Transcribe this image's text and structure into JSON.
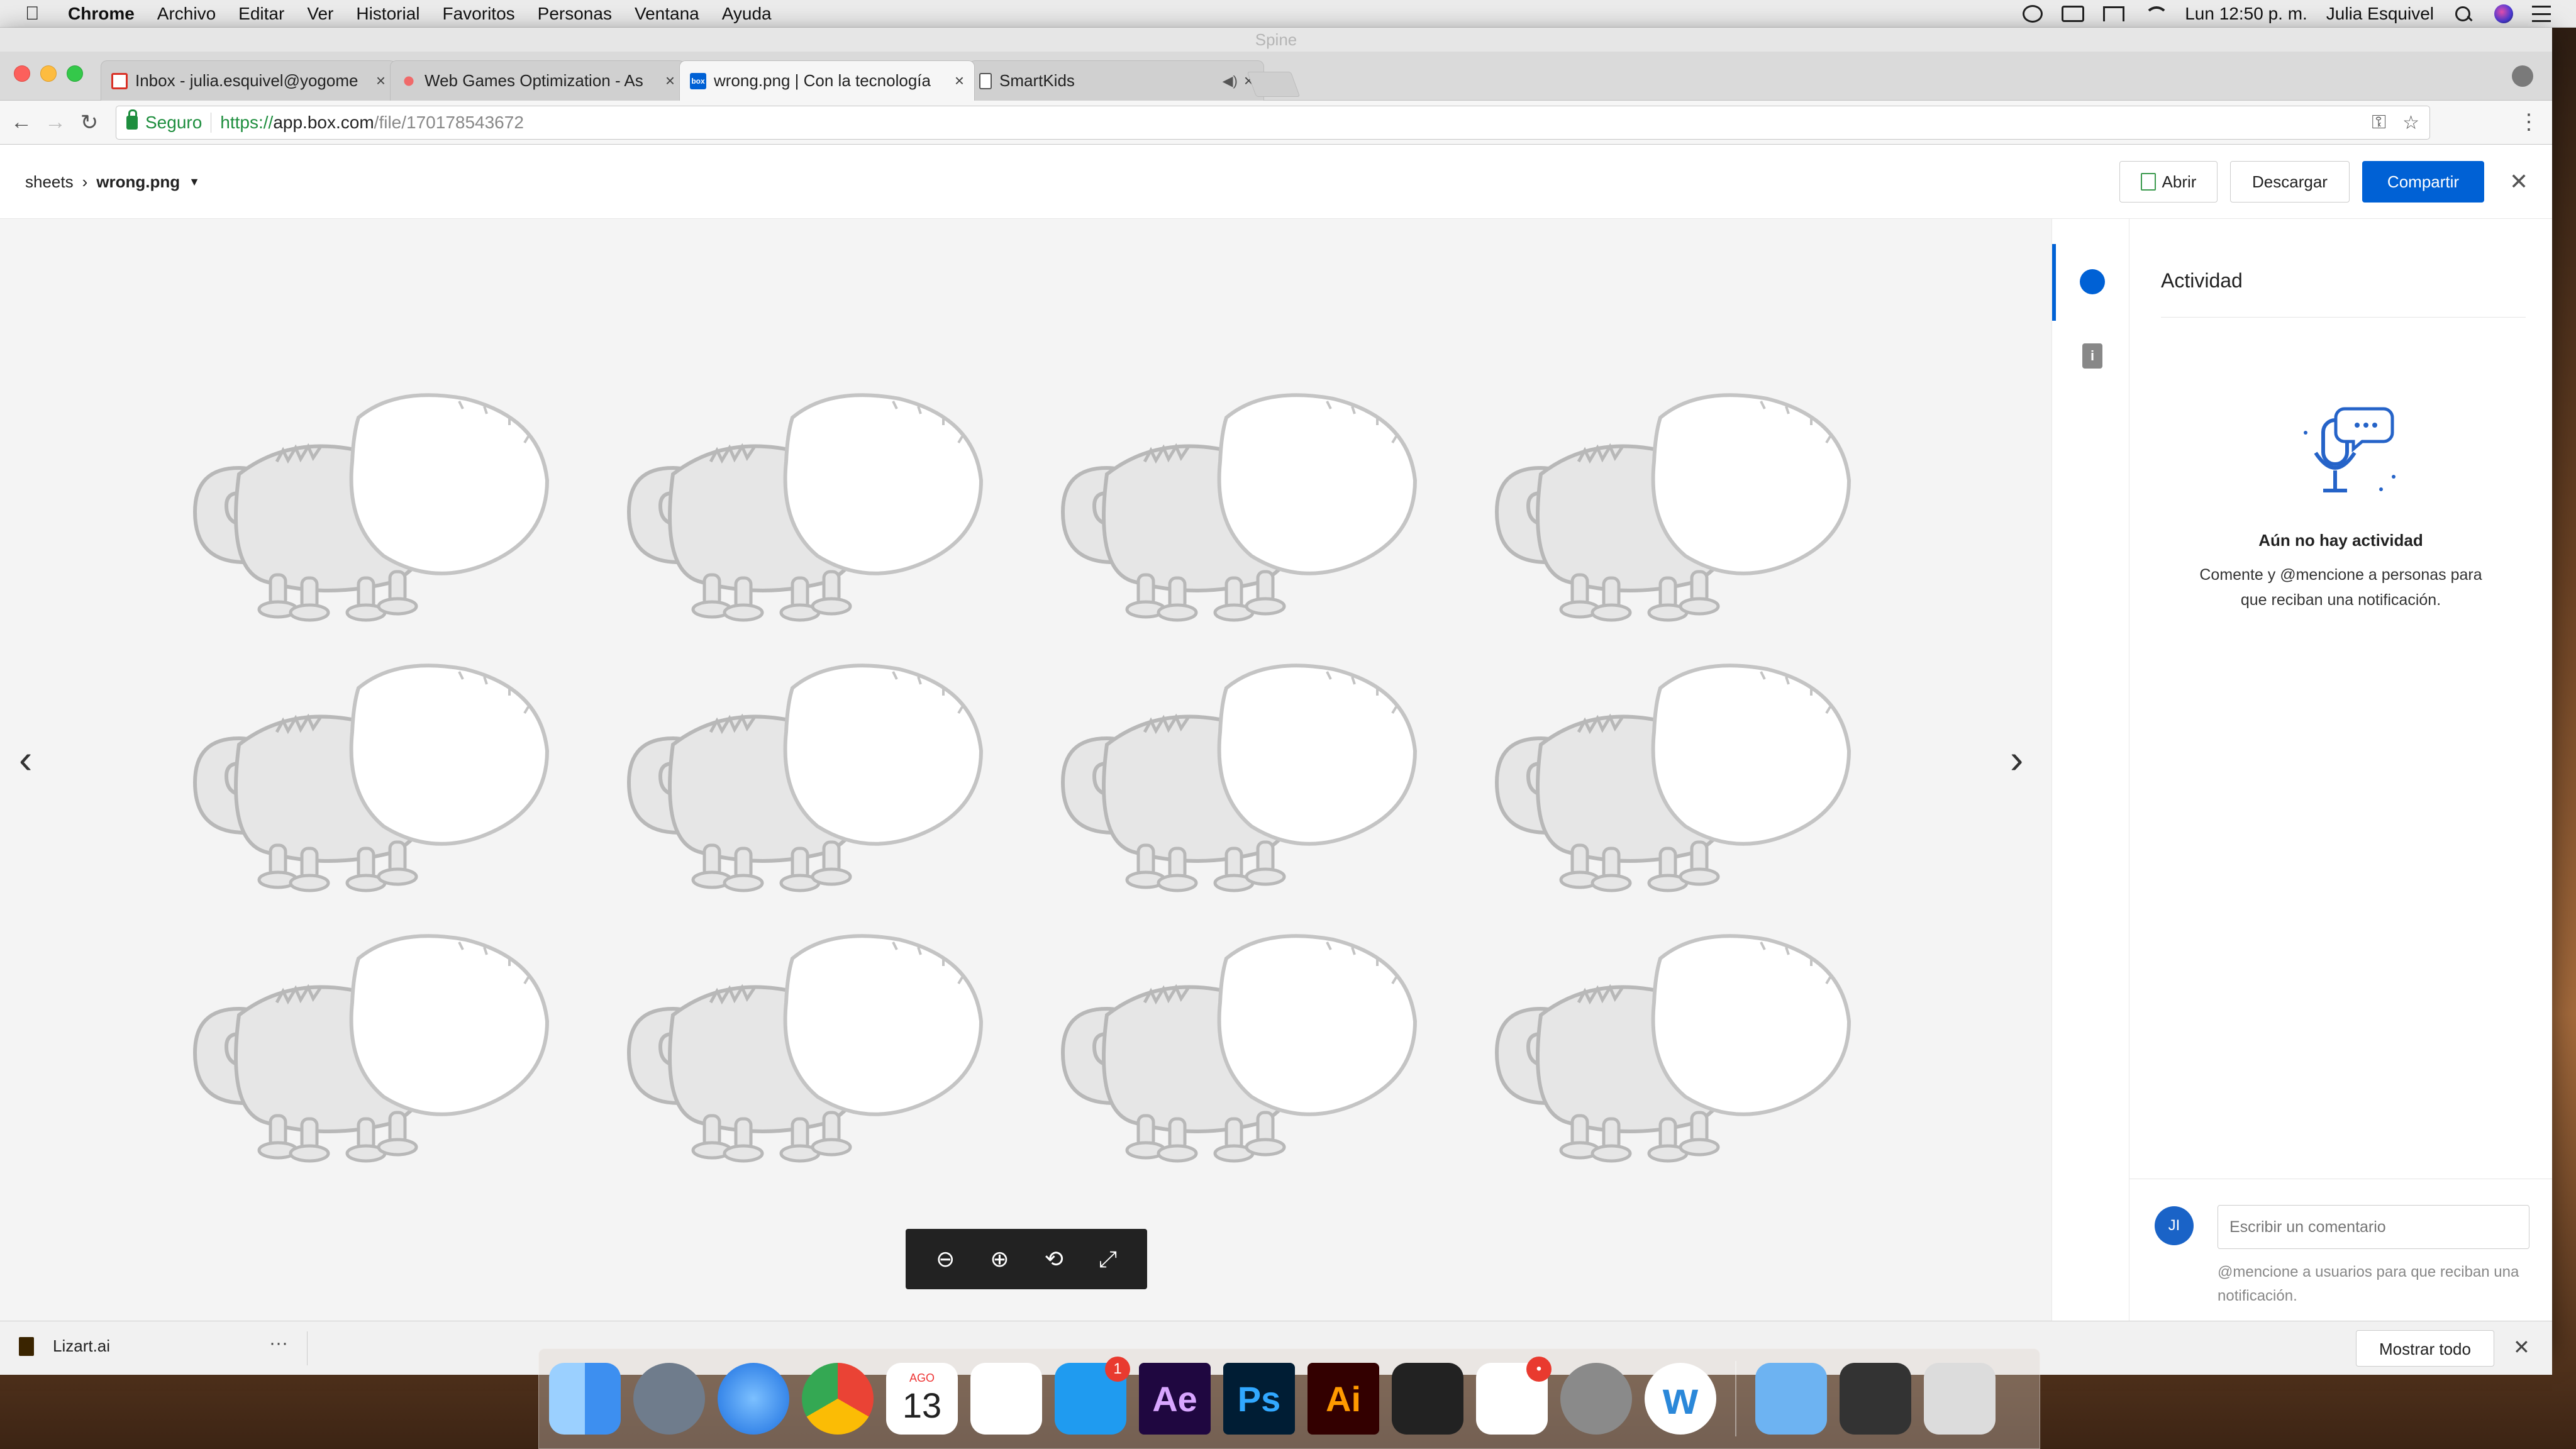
{
  "menubar": {
    "app_name": "Chrome",
    "menus": [
      "Archivo",
      "Editar",
      "Ver",
      "Historial",
      "Favoritos",
      "Personas",
      "Ventana",
      "Ayuda"
    ],
    "clock": "Lun 12:50 p. m.",
    "user": "Julia Esquivel",
    "status_icons": [
      "creative-cloud-icon",
      "screen-icon",
      "airplay-icon",
      "wifi-icon",
      "search-icon",
      "siri-icon",
      "notification-list-icon"
    ]
  },
  "window": {
    "title": "Spine",
    "tabs": [
      {
        "label": "Inbox - julia.esquivel@yogome",
        "favicon": "gmail-icon",
        "active": false
      },
      {
        "label": "Web Games Optimization - As",
        "favicon": "asana-icon",
        "active": false
      },
      {
        "label": "wrong.png | Con la tecnología",
        "favicon": "box-icon",
        "active": true
      },
      {
        "label": "SmartKids",
        "favicon": "document-icon",
        "active": false,
        "audio": true
      }
    ],
    "address": {
      "security_label": "Seguro",
      "scheme": "https://",
      "host": "app.box.com",
      "path": "/file/170178543672"
    }
  },
  "box": {
    "breadcrumb": {
      "parent": "sheets",
      "current": "wrong.png"
    },
    "buttons": {
      "open": "Abrir",
      "download": "Descargar",
      "share": "Compartir"
    },
    "activity": {
      "title": "Actividad",
      "empty_title": "Aún no hay actividad",
      "empty_body": "Comente y @mencione a personas para que reciban una notificación.",
      "avatar_initials": "JI",
      "comment_placeholder": "Escribir un comentario",
      "comment_hint": "@mencione a usuarios para que reciban una notificación."
    },
    "zoom_controls": [
      "zoom-out-icon",
      "zoom-in-icon",
      "rotate-icon",
      "fullscreen-icon"
    ],
    "preview_image": {
      "rows": 3,
      "columns": 4,
      "subject": "chameleon-outline"
    }
  },
  "downloads": {
    "file": "Lizart.ai",
    "show_all": "Mostrar todo"
  },
  "dock": {
    "apps": [
      {
        "name": "finder-icon",
        "color": "#3d9af0"
      },
      {
        "name": "launchpad-icon",
        "color": "#6f7c8c"
      },
      {
        "name": "safari-icon",
        "color": "#2f8ef4"
      },
      {
        "name": "chrome-icon",
        "color": "#ffffff"
      },
      {
        "name": "calendar-icon",
        "color": "#ffffff",
        "month": "AGO",
        "day": "13"
      },
      {
        "name": "reminders-icon",
        "color": "#ffffff"
      },
      {
        "name": "app-store-icon",
        "color": "#1f9bf0",
        "badge": "1"
      },
      {
        "name": "after-effects-icon",
        "color": "#1f0740",
        "text": "Ae",
        "text_color": "#d8a6ff"
      },
      {
        "name": "photoshop-icon",
        "color": "#001d34",
        "text": "Ps",
        "text_color": "#31a8ff"
      },
      {
        "name": "illustrator-icon",
        "color": "#330000",
        "text": "Ai",
        "text_color": "#ff9a00"
      },
      {
        "name": "spine-icon",
        "color": "#222222"
      },
      {
        "name": "slack-icon",
        "color": "#ffffff",
        "badge": "•"
      },
      {
        "name": "system-preferences-icon",
        "color": "#8a8a8a"
      },
      {
        "name": "wunderlist-icon",
        "color": "#ffffff"
      },
      {
        "name": "downloads-folder-icon",
        "color": "#6db3f2"
      },
      {
        "name": "recent-illustrator-file-icon",
        "color": "#333333"
      },
      {
        "name": "trash-icon",
        "color": "#dcdcdc"
      }
    ]
  }
}
